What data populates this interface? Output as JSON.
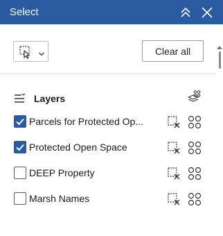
{
  "header": {
    "title": "Select",
    "collapse_icon": "double-chevron-up-icon",
    "close_icon": "close-icon"
  },
  "toolbar": {
    "select_tool_icon": "select-by-rectangle-icon",
    "dropdown_icon": "chevron-down-icon",
    "clear_all_label": "Clear all"
  },
  "layers": {
    "label": "Layers",
    "icon": "layers-list-icon",
    "action_icon": "layers-select-icon",
    "items": [
      {
        "name": "Parcels for Protected Op...",
        "checked": true
      },
      {
        "name": "Protected Open Space",
        "checked": true
      },
      {
        "name": "DEEP Property",
        "checked": false
      },
      {
        "name": "Marsh Names",
        "checked": false
      }
    ]
  },
  "colors": {
    "accent": "#2a5aa0",
    "header_text": "#ffffff"
  }
}
